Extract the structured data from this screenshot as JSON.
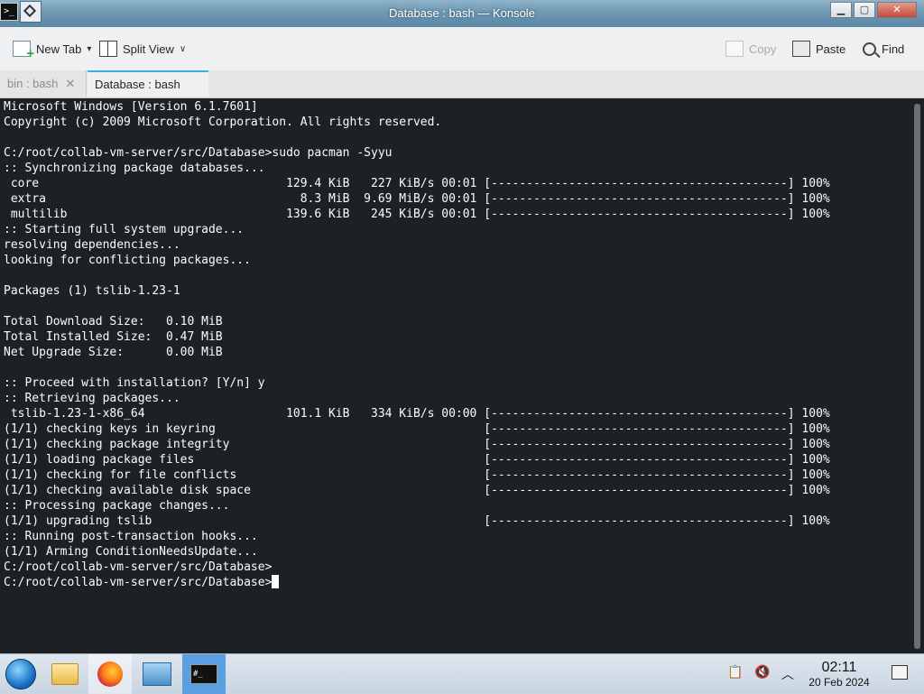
{
  "window": {
    "title": "Database : bash — Konsole",
    "app_icon": ">_",
    "minimize_glyph": "▁",
    "maximize_glyph": "▢",
    "close_glyph": "✕"
  },
  "toolbar": {
    "new_tab_label": "New Tab",
    "split_view_label": "Split View",
    "copy_label": "Copy",
    "paste_label": "Paste",
    "find_label": "Find",
    "dropdown_glyph": "▾",
    "split_chevron": "∨"
  },
  "tabs": [
    {
      "label": "bin : bash",
      "active": false,
      "close": "✕"
    },
    {
      "label": "Database : bash",
      "active": true,
      "close": "✕"
    }
  ],
  "terminal": {
    "lines": [
      "Microsoft Windows [Version 6.1.7601]",
      "Copyright (c) 2009 Microsoft Corporation. All rights reserved.",
      "",
      "C:/root/collab-vm-server/src/Database>sudo pacman -Syyu",
      ":: Synchronizing package databases...",
      " core                                   129.4 KiB   227 KiB/s 00:01 [------------------------------------------] 100%",
      " extra                                    8.3 MiB  9.69 MiB/s 00:01 [------------------------------------------] 100%",
      " multilib                               139.6 KiB   245 KiB/s 00:01 [------------------------------------------] 100%",
      ":: Starting full system upgrade...",
      "resolving dependencies...",
      "looking for conflicting packages...",
      "",
      "Packages (1) tslib-1.23-1",
      "",
      "Total Download Size:   0.10 MiB",
      "Total Installed Size:  0.47 MiB",
      "Net Upgrade Size:      0.00 MiB",
      "",
      ":: Proceed with installation? [Y/n] y",
      ":: Retrieving packages...",
      " tslib-1.23-1-x86_64                    101.1 KiB   334 KiB/s 00:00 [------------------------------------------] 100%",
      "(1/1) checking keys in keyring                                      [------------------------------------------] 100%",
      "(1/1) checking package integrity                                    [------------------------------------------] 100%",
      "(1/1) loading package files                                         [------------------------------------------] 100%",
      "(1/1) checking for file conflicts                                   [------------------------------------------] 100%",
      "(1/1) checking available disk space                                 [------------------------------------------] 100%",
      ":: Processing package changes...",
      "(1/1) upgrading tslib                                               [------------------------------------------] 100%",
      ":: Running post-transaction hooks...",
      "(1/1) Arming ConditionNeedsUpdate...",
      "C:/root/collab-vm-server/src/Database>",
      "C:/root/collab-vm-server/src/Database>"
    ]
  },
  "taskbar": {
    "items": [
      {
        "name": "start-button",
        "icon": "windows-orb-icon"
      },
      {
        "name": "file-explorer",
        "icon": "folder-icon"
      },
      {
        "name": "firefox",
        "icon": "firefox-icon"
      },
      {
        "name": "remote-desktop",
        "icon": "remote-desktop-icon"
      },
      {
        "name": "konsole",
        "icon": "terminal-icon",
        "glyph": "#_"
      }
    ],
    "tray": {
      "clipboard_glyph": "📋",
      "volume_glyph": "🔇",
      "arrow_glyph": "︿"
    },
    "clock": {
      "time": "02:11",
      "date": "20 Feb 2024"
    }
  },
  "colors": {
    "terminal_bg": "#1e2124",
    "terminal_fg": "#fcfcfc",
    "accent": "#3daee9"
  }
}
